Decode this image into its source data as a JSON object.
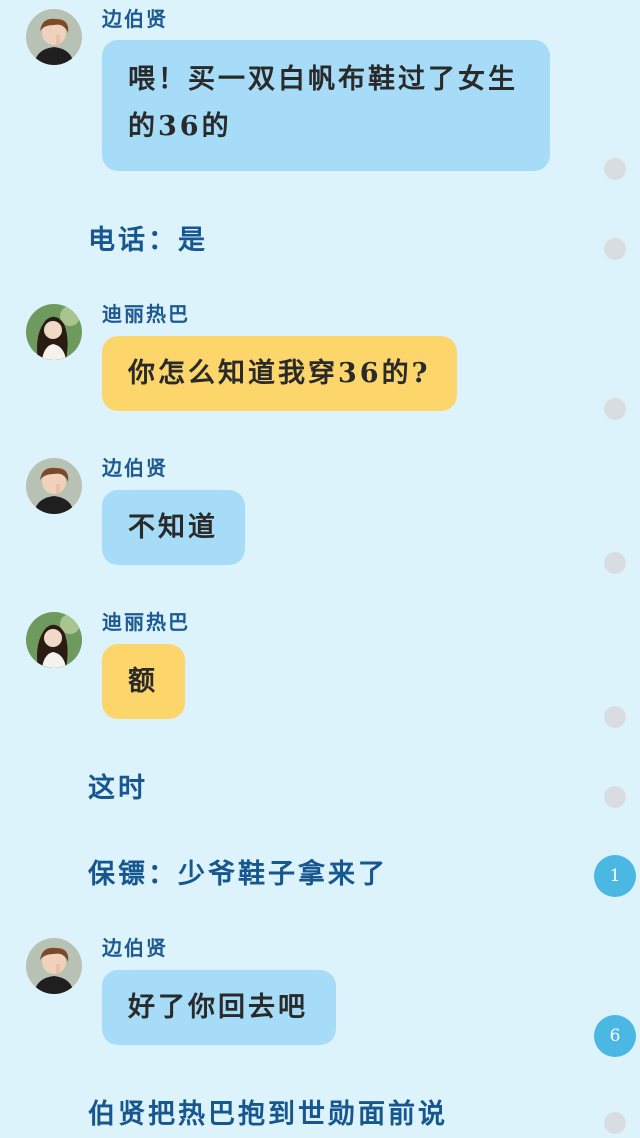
{
  "characters": {
    "boy": "边伯贤",
    "girl": "迪丽热巴"
  },
  "messages": {
    "m1": "喂！买一双白帆布鞋过了女生的36的",
    "m2": "你怎么知道我穿36的?",
    "m3": "不知道",
    "m4": "额",
    "m5": "好了你回去吧"
  },
  "narration": {
    "n1": "电话：是",
    "n2": "这时",
    "n3": "保镖：少爷鞋子拿来了",
    "n4": "伯贤把热巴抱到世勋面前说"
  },
  "comment_counts": {
    "c1": "1",
    "c2": "6"
  },
  "colors": {
    "background": "#ddf3fc",
    "blue_bubble": "#a6dcf7",
    "yellow_bubble": "#fcd66b",
    "name_text": "#1d5a92",
    "narration_text": "#17578f",
    "comment_badge": "#4ab8e2",
    "comment_dot": "#d7dde0"
  },
  "icons": {
    "avatar_boy": "boy-avatar-icon",
    "avatar_girl": "girl-avatar-icon",
    "comment_dot": "comment-dot-icon"
  }
}
